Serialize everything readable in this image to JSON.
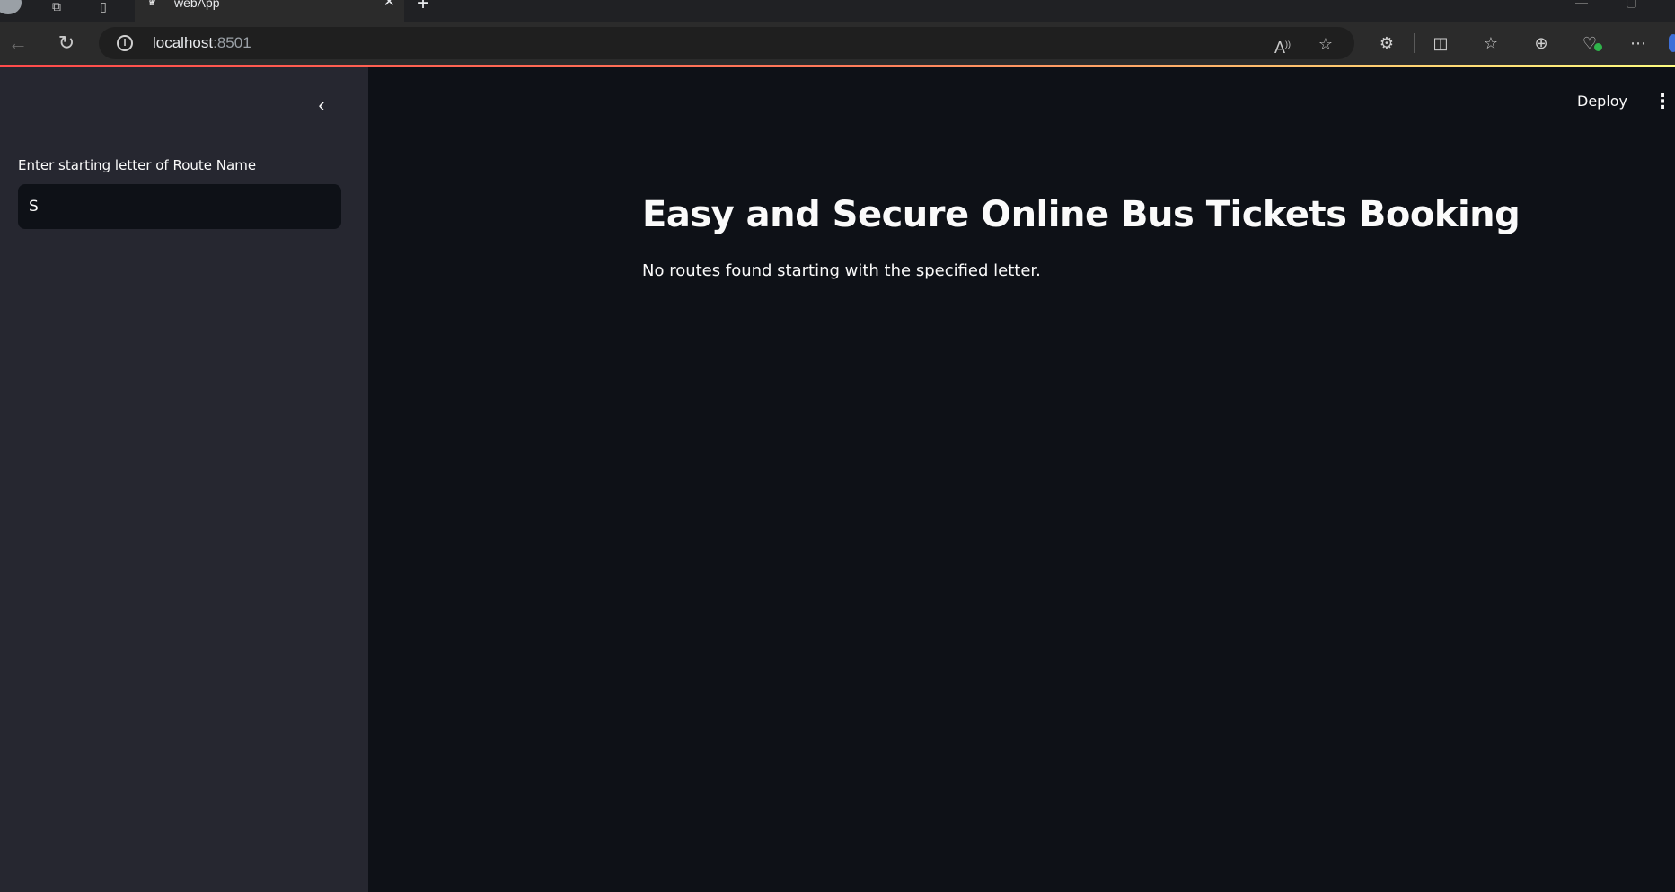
{
  "browser": {
    "tab_title": "webApp",
    "url_host": "localhost",
    "url_port": ":8501"
  },
  "app": {
    "deploy_label": "Deploy",
    "title": "Easy and Secure Online Bus Tickets Booking",
    "status_message": "No routes found starting with the specified letter."
  },
  "sidebar": {
    "input_label": "Enter starting letter of Route Name",
    "input_value": "S"
  },
  "colors": {
    "background": "#0e1117",
    "sidebar": "#262730",
    "accent_red": "#ff4b4b",
    "text": "#fafafa"
  }
}
